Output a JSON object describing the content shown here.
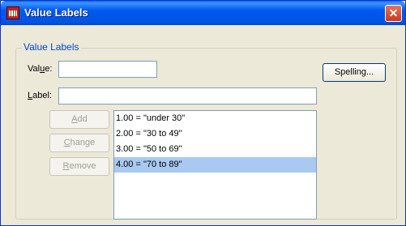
{
  "window": {
    "title": "Value Labels",
    "close_glyph": "✕"
  },
  "group": {
    "title": "Value Labels"
  },
  "fields": {
    "value": {
      "label_pre": "Val",
      "label_key": "u",
      "label_post": "e:",
      "value": ""
    },
    "label": {
      "label_pre": "",
      "label_key": "L",
      "label_post": "abel:",
      "value": ""
    }
  },
  "buttons": {
    "spelling": "Spelling...",
    "add": {
      "pre": "",
      "key": "A",
      "post": "dd",
      "enabled": false
    },
    "change": {
      "pre": "",
      "key": "C",
      "post": "hange",
      "enabled": false
    },
    "remove": {
      "pre": "",
      "key": "R",
      "post": "emove",
      "enabled": false
    }
  },
  "list": {
    "items": [
      "1.00 = \"under 30\"",
      "2.00 = \"30 to 49\"",
      "3.00 = \"50 to 69\"",
      "4.00 = \"70 to 89\""
    ],
    "selected_index": 3
  }
}
